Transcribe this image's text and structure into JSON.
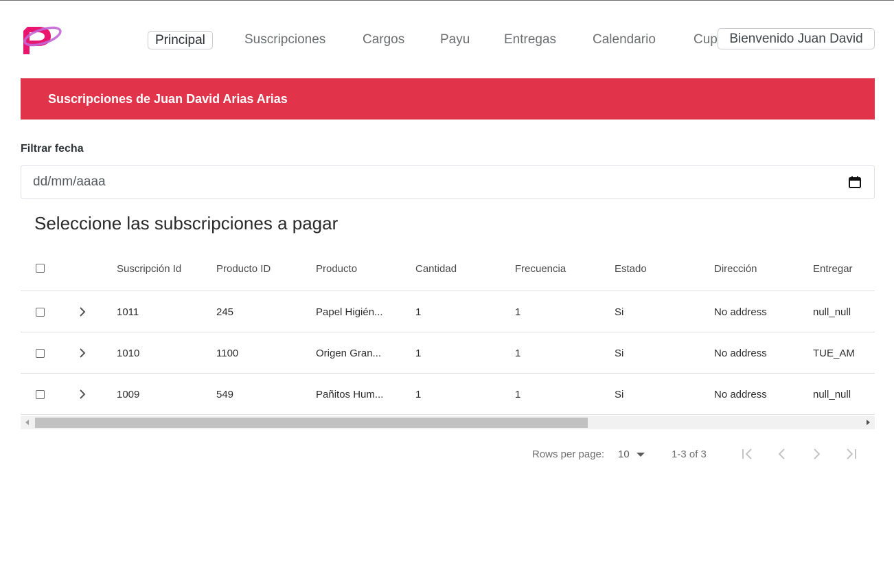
{
  "nav": {
    "items": [
      {
        "label": "Principal",
        "active": true
      },
      {
        "label": "Suscripciones"
      },
      {
        "label": "Cargos"
      },
      {
        "label": "Payu"
      },
      {
        "label": "Entregas"
      },
      {
        "label": "Calendario"
      },
      {
        "label": "Cupones"
      }
    ],
    "welcome": "Bienvenido Juan David"
  },
  "banner": {
    "title": "Suscripciones de Juan David Arias Arias"
  },
  "filter": {
    "label": "Filtrar fecha",
    "placeholder": "dd/mm/aaaa"
  },
  "table": {
    "title": "Seleccione las subscripciones a pagar",
    "headers": [
      "Suscripción Id",
      "Producto ID",
      "Producto",
      "Cantidad",
      "Frecuencia",
      "Estado",
      "Dirección",
      "Entregar"
    ],
    "rows": [
      [
        "1011",
        "245",
        "Papel Higién...",
        "1",
        "1",
        "Si",
        "No address",
        "null_null"
      ],
      [
        "1010",
        "1100",
        "Origen Gran...",
        "1",
        "1",
        "Si",
        "No address",
        "TUE_AM"
      ],
      [
        "1009",
        "549",
        "Pañitos Hum...",
        "1",
        "1",
        "Si",
        "No address",
        "null_null"
      ]
    ]
  },
  "pagination": {
    "rows_per_page_label": "Rows per page:",
    "rows_per_page": "10",
    "range": "1-3 of 3"
  },
  "colors": {
    "banner": "#e1334a",
    "logo_pink": "#e8166f",
    "logo_violet": "#c267d6"
  },
  "icons": [
    "logo-icon",
    "calendar-icon",
    "chevron-right-icon",
    "first-page-icon",
    "prev-page-icon",
    "next-page-icon",
    "last-page-icon"
  ]
}
